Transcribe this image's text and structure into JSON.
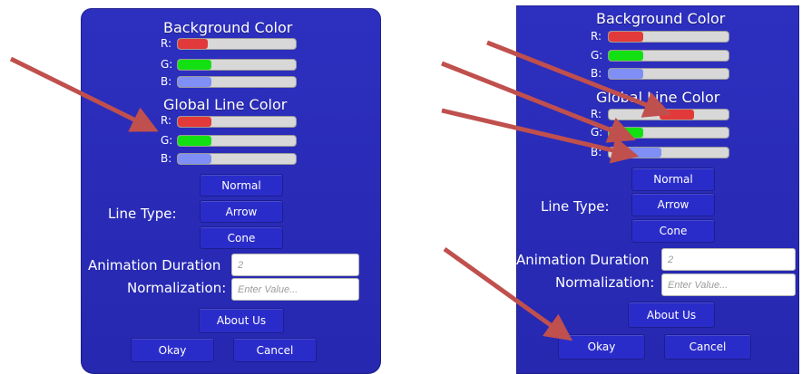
{
  "left_dialog": {
    "background_color_title": "Background Color",
    "global_line_color_title": "Global Line Color",
    "channels": {
      "r": "R:",
      "g": "G:",
      "b": "B:"
    },
    "background_color": {
      "r": 0.25,
      "g": 0.28,
      "b": 0.28
    },
    "global_line_color": {
      "r": 0.28,
      "g": 0.28,
      "b": 0.28
    },
    "line_type_label": "Line Type:",
    "line_type_options": [
      "Normal",
      "Arrow",
      "Cone"
    ],
    "animation_duration_label": "Animation Duration",
    "animation_duration_value": "2",
    "normalization_label": "Normalization:",
    "normalization_placeholder": "Enter Value...",
    "about_button": "About Us",
    "okay_button": "Okay",
    "cancel_button": "Cancel"
  },
  "right_dialog": {
    "background_color_title": "Background Color",
    "global_line_color_title": "Global Line Color",
    "channels": {
      "r": "R:",
      "g": "G:",
      "b": "B:"
    },
    "background_color": {
      "r": 0.28,
      "g": 0.28,
      "b": 0.28
    },
    "global_line_color": {
      "r": 0.7,
      "g": 0.28,
      "b": 0.43
    },
    "line_type_label": "Line Type:",
    "line_type_options": [
      "Normal",
      "Arrow",
      "Cone"
    ],
    "animation_duration_label": "Animation Duration",
    "animation_duration_value": "2",
    "normalization_label": "Normalization:",
    "normalization_placeholder": "Enter Value...",
    "about_button": "About Us",
    "okay_button": "Okay",
    "cancel_button": "Cancel"
  },
  "colors": {
    "panel": "#2a2cc0",
    "arrow": "#c0504d",
    "slider_red": "#e23a3a",
    "slider_green": "#13e013",
    "slider_blue": "#7f8ff5"
  }
}
